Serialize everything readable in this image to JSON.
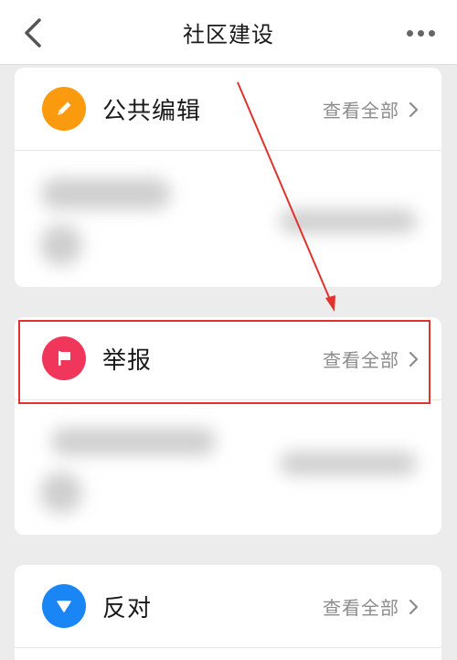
{
  "header": {
    "title": "社区建设",
    "back_icon": "chevron-left-icon",
    "more_icon": "more-horizontal-icon"
  },
  "sections": [
    {
      "title": "公共编辑",
      "view_all": "查看全部",
      "icon": "pencil-icon",
      "color": "#fa9a0f"
    },
    {
      "title": "举报",
      "view_all": "查看全部",
      "icon": "flag-icon",
      "color": "#f0365a"
    },
    {
      "title": "反对",
      "view_all": "查看全部",
      "icon": "triangle-down-icon",
      "color": "#1a86f5"
    }
  ],
  "colors": {
    "annotation_red": "#e0332e",
    "muted_text": "#8c8c8c",
    "background": "#ececec"
  }
}
